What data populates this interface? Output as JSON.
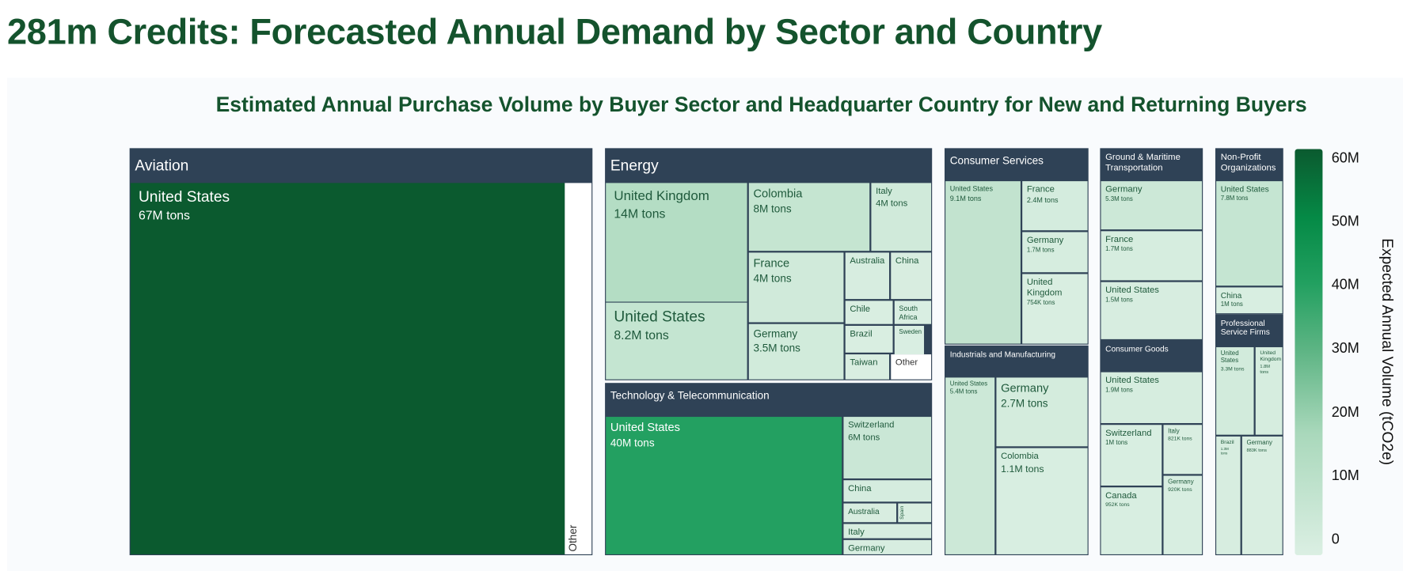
{
  "page_title": "281m Credits: Forecasted Annual Demand by Sector and Country",
  "chart_data": {
    "type": "treemap",
    "title": "Estimated Annual Purchase Volume by Buyer Sector and Headquarter Country for New and Returning Buyers",
    "colorbar": {
      "label": "Expected Annual Volume (tCO2e)",
      "range": [
        0,
        60000000
      ],
      "ticks": [
        "0",
        "10M",
        "20M",
        "30M",
        "40M",
        "50M",
        "60M"
      ],
      "colors": [
        "#dbefe3",
        "#a9d8bb",
        "#22a060",
        "#058a46",
        "#0b5a2f"
      ]
    },
    "header_color": "#2f4256",
    "sectors": [
      {
        "name": "Aviation",
        "countries": [
          {
            "name": "United States",
            "label": "67M tons",
            "value": 67000000
          },
          {
            "name": "Other",
            "value": 3000000
          }
        ]
      },
      {
        "name": "Energy",
        "countries": [
          {
            "name": "United Kingdom",
            "label": "14M tons",
            "value": 14000000
          },
          {
            "name": "United States",
            "label": "8.2M tons",
            "value": 8200000
          },
          {
            "name": "Colombia",
            "label": "8M tons",
            "value": 8000000
          },
          {
            "name": "Italy",
            "label": "4M tons",
            "value": 4000000
          },
          {
            "name": "France",
            "label": "4M tons",
            "value": 4000000
          },
          {
            "name": "Germany",
            "label": "3.5M tons",
            "value": 3500000
          },
          {
            "name": "Australia",
            "value": 1300000
          },
          {
            "name": "China",
            "value": 1200000
          },
          {
            "name": "Chile",
            "value": 700000
          },
          {
            "name": "South Africa",
            "value": 600000
          },
          {
            "name": "Brazil",
            "value": 800000
          },
          {
            "name": "Sweden",
            "value": 600000
          },
          {
            "name": "Taiwan",
            "value": 700000
          },
          {
            "name": "Other",
            "value": 600000
          }
        ]
      },
      {
        "name": "Technology & Telecommunication",
        "countries": [
          {
            "name": "United States",
            "label": "40M tons",
            "value": 40000000
          },
          {
            "name": "Switzerland",
            "label": "6M tons",
            "value": 6000000
          },
          {
            "name": "China",
            "value": 2000000
          },
          {
            "name": "Australia",
            "value": 1200000
          },
          {
            "name": "Spain",
            "value": 700000
          },
          {
            "name": "Italy",
            "value": 1300000
          },
          {
            "name": "Germany",
            "value": 1300000
          }
        ]
      },
      {
        "name": "Consumer Services",
        "countries": [
          {
            "name": "United States",
            "label": "9.1M tons",
            "value": 9100000
          },
          {
            "name": "France",
            "label": "2.4M tons",
            "value": 2400000
          },
          {
            "name": "Germany",
            "label": "1.7M tons",
            "value": 1700000
          },
          {
            "name": "United Kingdom",
            "label": "754K tons",
            "value": 754000
          }
        ]
      },
      {
        "name": "Industrials and Manufacturing",
        "countries": [
          {
            "name": "United States",
            "label": "5.4M tons",
            "value": 5400000
          },
          {
            "name": "Germany",
            "label": "2.7M tons",
            "value": 2700000
          },
          {
            "name": "Colombia",
            "label": "1.1M tons",
            "value": 1100000
          }
        ]
      },
      {
        "name": "Ground & Maritime Transportation",
        "countries": [
          {
            "name": "Germany",
            "label": "5.3M tons",
            "value": 5300000
          },
          {
            "name": "France",
            "label": "1.7M tons",
            "value": 1700000
          },
          {
            "name": "United States",
            "label": "1.5M tons",
            "value": 1500000
          }
        ]
      },
      {
        "name": "Consumer Goods",
        "countries": [
          {
            "name": "United States",
            "label": "1.9M tons",
            "value": 1900000
          },
          {
            "name": "Switzerland",
            "label": "1M tons",
            "value": 1000000
          },
          {
            "name": "Canada",
            "label": "952K tons",
            "value": 952000
          },
          {
            "name": "Italy",
            "label": "821K tons",
            "value": 821000
          },
          {
            "name": "Germany",
            "label": "920K tons",
            "value": 920000
          }
        ]
      },
      {
        "name": "Non-Profit Organizations",
        "countries": [
          {
            "name": "United States",
            "label": "7.8M tons",
            "value": 7800000
          },
          {
            "name": "China",
            "label": "1M tons",
            "value": 1000000
          }
        ]
      },
      {
        "name": "Professional Service Firms",
        "countries": [
          {
            "name": "United States",
            "label": "3.3M tons",
            "value": 3300000
          },
          {
            "name": "United Kingdom",
            "label": "1.8M tons",
            "value": 1800000
          },
          {
            "name": "Brazil",
            "label": "1.3M tons",
            "value": 1300000
          },
          {
            "name": "Germany",
            "label": "883K tons",
            "value": 883000
          }
        ]
      }
    ]
  }
}
